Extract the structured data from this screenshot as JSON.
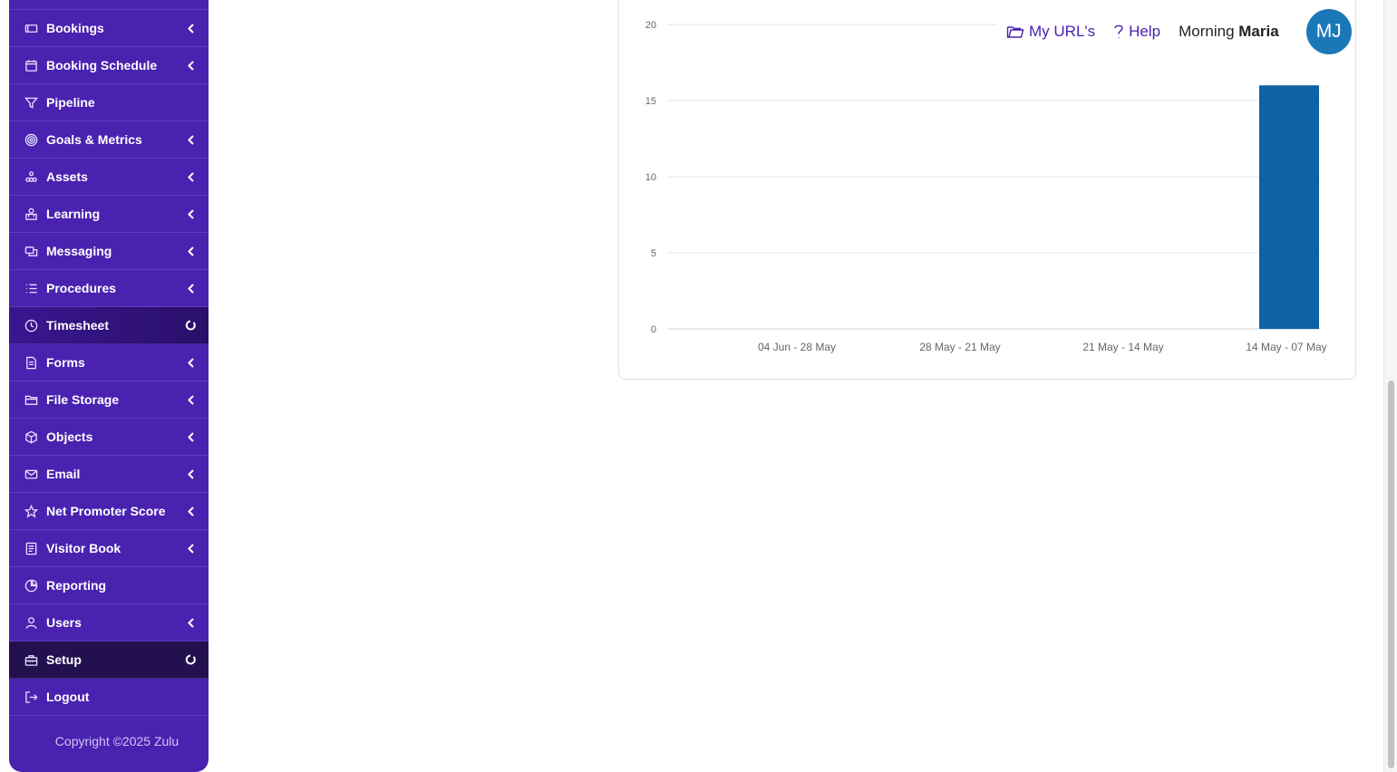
{
  "sidebar": {
    "items": [
      {
        "label": "Bookings",
        "icon": "ticket-icon",
        "marker": "chevron"
      },
      {
        "label": "Booking Schedule",
        "icon": "calendar-icon",
        "marker": "chevron"
      },
      {
        "label": "Pipeline",
        "icon": "filter-icon",
        "marker": "none"
      },
      {
        "label": "Goals & Metrics",
        "icon": "target-icon",
        "marker": "chevron"
      },
      {
        "label": "Assets",
        "icon": "boxes-icon",
        "marker": "chevron"
      },
      {
        "label": "Learning",
        "icon": "learning-icon",
        "marker": "chevron"
      },
      {
        "label": "Messaging",
        "icon": "messages-icon",
        "marker": "chevron"
      },
      {
        "label": "Procedures",
        "icon": "list-icon",
        "marker": "chevron"
      },
      {
        "label": "Timesheet",
        "icon": "clock-icon",
        "marker": "spinner"
      },
      {
        "label": "Forms",
        "icon": "document-icon",
        "marker": "chevron"
      },
      {
        "label": "File Storage",
        "icon": "folder-icon",
        "marker": "chevron"
      },
      {
        "label": "Objects",
        "icon": "cube-icon",
        "marker": "chevron"
      },
      {
        "label": "Email",
        "icon": "envelope-icon",
        "marker": "chevron"
      },
      {
        "label": "Net Promoter Score",
        "icon": "star-icon",
        "marker": "chevron"
      },
      {
        "label": "Visitor Book",
        "icon": "book-icon",
        "marker": "chevron"
      },
      {
        "label": "Reporting",
        "icon": "pie-icon",
        "marker": "none"
      },
      {
        "label": "Users",
        "icon": "user-icon",
        "marker": "chevron"
      },
      {
        "label": "Setup",
        "icon": "toolbox-icon",
        "marker": "spinner"
      },
      {
        "label": "Logout",
        "icon": "logout-icon",
        "marker": "none"
      }
    ],
    "copyright": "Copyright ©2025 Zulu"
  },
  "header": {
    "my_urls": "My URL's",
    "help": "Help",
    "greeting": "Morning",
    "user_name": "Maria",
    "avatar_initials": "MJ"
  },
  "colors": {
    "sidebar": "#4a22b0",
    "bar": "#0e62a6",
    "avatar": "#1b78b8"
  },
  "chart_data": {
    "type": "bar",
    "categories": [
      "04 Jun - 28 May",
      "28 May - 21 May",
      "21 May - 14 May",
      "14 May - 07 May"
    ],
    "values": [
      0,
      0,
      0,
      16
    ],
    "ylim": [
      0,
      20
    ],
    "yticks": [
      0,
      5,
      10,
      15,
      20
    ],
    "grid": true
  }
}
